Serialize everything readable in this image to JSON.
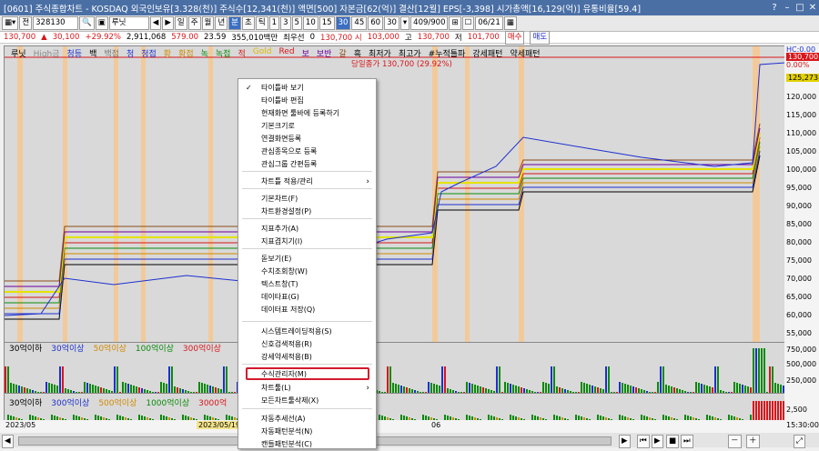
{
  "window": {
    "title": "[0601] 주식종합차트 - KOSDAQ 외국인보유[3.328(천)] 주식수[12,341(천)] 액면[500] 자본금[62(억)] 결산[12월] EPS[-3,398] 시가총액[16,129(억)] 유통비율[59.4]"
  },
  "toolbar": {
    "prev": "전",
    "code": "328130",
    "stock_type": "루닛",
    "periods": [
      "일",
      "주",
      "월",
      "년",
      "분",
      "초",
      "틱"
    ],
    "intervals": [
      "1",
      "3",
      "5",
      "10",
      "15",
      "30",
      "45",
      "60"
    ],
    "count": "30",
    "range": "409/900",
    "date": "06/21"
  },
  "quote": {
    "price": "130,700",
    "change": "30,100",
    "pct": "+29.92%",
    "volume": "2,911,068",
    "amount": "579.00",
    "turnover": "23.59",
    "amount2": "355,010백만",
    "priority_label": "최우선",
    "priority_val": "0",
    "open_label": "130,700 시",
    "open": "103,000",
    "high_label": "고",
    "high": "130,700",
    "low_label": "저",
    "low": "101,700",
    "buy": "매수",
    "sell": "매도"
  },
  "chart": {
    "series_labels": [
      {
        "text": "루닛",
        "color": "#000000"
      },
      {
        "text": "High금",
        "color": "#8a8a8a"
      },
      {
        "text": "청등",
        "color": "#1d2fd0"
      },
      {
        "text": "백",
        "color": "#000000"
      },
      {
        "text": "백접",
        "color": "#7a7a7a"
      },
      {
        "text": "청",
        "color": "#1d2fd0"
      },
      {
        "text": "청접",
        "color": "#1d2fd0"
      },
      {
        "text": "황",
        "color": "#d08a00"
      },
      {
        "text": "황접",
        "color": "#d08a00"
      },
      {
        "text": "녹",
        "color": "#0a8a0a"
      },
      {
        "text": "녹접",
        "color": "#0a8a0a"
      },
      {
        "text": "적",
        "color": "#d8161b"
      },
      {
        "text": "Gold",
        "color": "#e3b800"
      },
      {
        "text": "Red",
        "color": "#d8161b"
      },
      {
        "text": "보",
        "color": "#6a00a0"
      },
      {
        "text": "보반",
        "color": "#6a00a0"
      },
      {
        "text": "갈",
        "color": "#8a4a1a"
      },
      {
        "text": "흑",
        "color": "#000000"
      },
      {
        "text": "최저가",
        "color": "#000000"
      },
      {
        "text": "최고가",
        "color": "#000000"
      },
      {
        "text": "#누적틀파",
        "color": "#000000"
      },
      {
        "text": "강세패턴",
        "color": "#000000"
      },
      {
        "text": "약세패턴",
        "color": "#000000"
      }
    ],
    "upper_limit_label": "당일종가 130,700 (29.92%)",
    "hc_label": "HC:0.00",
    "price_tag": "130,700",
    "pct_tag": "0.00%",
    "level_tag": "125,273",
    "y_ticks": [
      "120,000",
      "115,000",
      "110,000",
      "105,000",
      "100,000",
      "95,000",
      "90,000",
      "85,000",
      "80,000",
      "75,000",
      "70,000",
      "65,000",
      "60,000",
      "55,000"
    ],
    "vol_ticks": [
      "750,000",
      "500,000",
      "250,000"
    ],
    "vol2_tick": "2,500",
    "vol_labels_1": [
      {
        "text": "30억이하",
        "color": "#000000"
      },
      {
        "text": "30억이상",
        "color": "#1d2fd0"
      },
      {
        "text": "50억이상",
        "color": "#d08a00"
      },
      {
        "text": "100억이상",
        "color": "#0a8a0a"
      },
      {
        "text": "300억이상",
        "color": "#d8161b"
      }
    ],
    "vol_labels_2": [
      {
        "text": "30억이하",
        "color": "#000000"
      },
      {
        "text": "300억이상",
        "color": "#1d2fd0"
      },
      {
        "text": "500억이상",
        "color": "#d08a00"
      },
      {
        "text": "1000억이상",
        "color": "#0a8a0a"
      },
      {
        "text": "3000억",
        "color": "#d8161b"
      }
    ],
    "dates": [
      "2023/05",
      "2023/05/19(",
      "06"
    ],
    "time": "15:30:00"
  },
  "context_menu": {
    "items": [
      {
        "label": "타이틀바 보기",
        "checked": true
      },
      {
        "label": "타이틀바 편집"
      },
      {
        "label": "현재화면 툴바에 등록하기"
      },
      {
        "label": "기본크기로"
      },
      {
        "label": "연결화면등록"
      },
      {
        "label": "관심종목으로 등록"
      },
      {
        "label": "관심그룹 간편등록"
      },
      {
        "label": "차트틀 적용/관리",
        "submenu": true
      },
      {
        "label": "기본차트(F)"
      },
      {
        "label": "차트환경설정(P)"
      },
      {
        "label": "지표추가(A)"
      },
      {
        "label": "지표겹치기(I)"
      },
      {
        "label": "돋보기(E)"
      },
      {
        "label": "수치조회창(W)"
      },
      {
        "label": "텍스트창(T)"
      },
      {
        "label": "데이타표(G)"
      },
      {
        "label": "데이터표 저장(Q)"
      },
      {
        "label": "시스템트레이딩적용(S)"
      },
      {
        "label": "신호검색적용(R)"
      },
      {
        "label": "강세약세적용(B)"
      },
      {
        "label": "수식관리자(M)",
        "highlighted": true
      },
      {
        "label": "차트툴(L)",
        "submenu": true
      },
      {
        "label": "모든차트툴삭제(X)"
      },
      {
        "label": "자동추세선(A)"
      },
      {
        "label": "자동패턴분석(N)"
      },
      {
        "label": "캔들패턴분석(C)"
      }
    ]
  }
}
